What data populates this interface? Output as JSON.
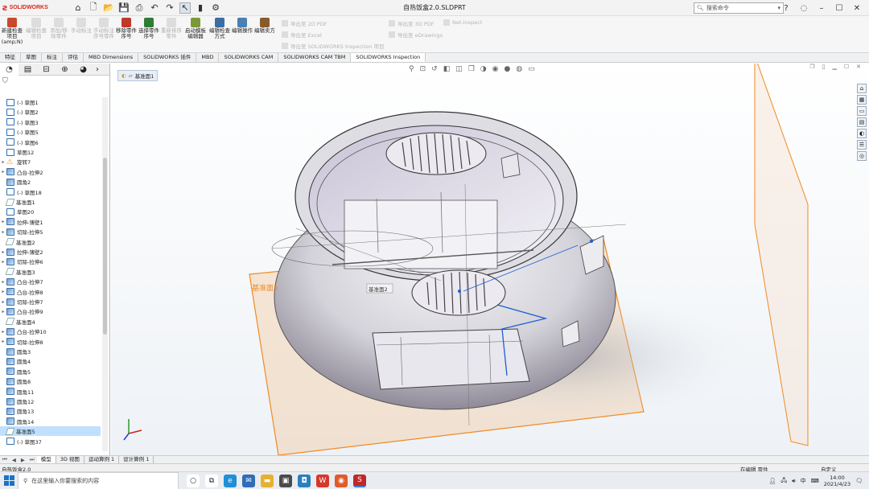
{
  "app": {
    "brand": "SOLIDWORKS",
    "window_title": "自热饭盒2.0.SLDPRT",
    "search_placeholder": "搜索命令",
    "quick_access": [
      "home-icon",
      "new-icon",
      "open-icon",
      "save-icon",
      "print-icon",
      "undo-icon",
      "redo-icon",
      "select-icon",
      "traffic-light-icon",
      "options-icon"
    ]
  },
  "ribbon": {
    "buttons": [
      {
        "label": "新建检查项目(amp;N)",
        "enabled": true,
        "color": "#c84a2a"
      },
      {
        "label": "编辑检查项目",
        "enabled": false,
        "color": "#dddddd"
      },
      {
        "label": "添加/移除零件",
        "enabled": false,
        "color": "#dddddd"
      },
      {
        "label": "手动标注",
        "enabled": false,
        "color": "#dddddd"
      },
      {
        "label": "手动标注序号零件",
        "enabled": false,
        "color": "#dddddd"
      },
      {
        "label": "移除零件序号",
        "enabled": true,
        "color": "#c0392b"
      },
      {
        "label": "选择零件序号",
        "enabled": true,
        "color": "#2e7d32"
      },
      {
        "label": "重新排序零件",
        "enabled": false,
        "color": "#dddddd"
      },
      {
        "label": "启动模板编辑器",
        "enabled": true,
        "color": "#7a9a3a"
      },
      {
        "label": "编辑检查方式",
        "enabled": true,
        "color": "#3a6ea5"
      },
      {
        "label": "编辑操作",
        "enabled": true,
        "color": "#4a7fb5"
      },
      {
        "label": "编辑卖方",
        "enabled": true,
        "color": "#8a5a2a"
      }
    ],
    "small_items": [
      "导出至 2D PDF",
      "导出至 Excel",
      "导出至 SOLIDWORKS Inspection 项目",
      "导出至 3D PDF",
      "导出至 eDrawings",
      "Net-Inspect"
    ]
  },
  "command_tabs": [
    "特征",
    "草图",
    "标注",
    "评估",
    "MBD Dimensions",
    "SOLIDWORKS 插件",
    "MBD",
    "SOLIDWORKS CAM",
    "SOLIDWORKS CAM TBM",
    "SOLIDWORKS Inspection"
  ],
  "active_command_tab": "SOLIDWORKS Inspection",
  "feature_tree": {
    "panel_tabs": [
      "feature-manager-icon",
      "property-manager-icon",
      "configuration-manager-icon",
      "dimxpert-icon",
      "display-manager-icon"
    ],
    "items": [
      {
        "label": "(-) 草图1",
        "type": "sketch",
        "expand": ""
      },
      {
        "label": "(-) 草图2",
        "type": "sketch",
        "expand": ""
      },
      {
        "label": "(-) 草图3",
        "type": "sketch",
        "expand": ""
      },
      {
        "label": "(-) 草图5",
        "type": "sketch",
        "expand": ""
      },
      {
        "label": "(-) 草图6",
        "type": "sketch",
        "expand": ""
      },
      {
        "label": "草图12",
        "type": "sketch",
        "expand": ""
      },
      {
        "label": "旋转7",
        "type": "warn",
        "expand": "▸"
      },
      {
        "label": "凸台-拉伸2",
        "type": "feat",
        "expand": "▸"
      },
      {
        "label": "圆角2",
        "type": "feat",
        "expand": ""
      },
      {
        "label": "(-) 草图18",
        "type": "sketch",
        "expand": ""
      },
      {
        "label": "基准面1",
        "type": "plane",
        "expand": ""
      },
      {
        "label": "草图20",
        "type": "sketch",
        "expand": ""
      },
      {
        "label": "拉伸-薄壁1",
        "type": "feat",
        "expand": "▸"
      },
      {
        "label": "切除-拉伸5",
        "type": "feat",
        "expand": "▸"
      },
      {
        "label": "基准面2",
        "type": "plane",
        "expand": ""
      },
      {
        "label": "拉伸-薄壁2",
        "type": "feat",
        "expand": "▸"
      },
      {
        "label": "切除-拉伸6",
        "type": "feat",
        "expand": "▸"
      },
      {
        "label": "基准面3",
        "type": "plane",
        "expand": ""
      },
      {
        "label": "凸台-拉伸7",
        "type": "feat",
        "expand": "▸"
      },
      {
        "label": "凸台-拉伸8",
        "type": "feat",
        "expand": "▸"
      },
      {
        "label": "切除-拉伸7",
        "type": "feat",
        "expand": "▸"
      },
      {
        "label": "凸台-拉伸9",
        "type": "feat",
        "expand": "▸"
      },
      {
        "label": "基准面4",
        "type": "plane",
        "expand": ""
      },
      {
        "label": "凸台-拉伸10",
        "type": "feat",
        "expand": "▸"
      },
      {
        "label": "切除-拉伸8",
        "type": "feat",
        "expand": "▸"
      },
      {
        "label": "圆角3",
        "type": "feat",
        "expand": ""
      },
      {
        "label": "圆角4",
        "type": "feat",
        "expand": ""
      },
      {
        "label": "圆角5",
        "type": "feat",
        "expand": ""
      },
      {
        "label": "圆角8",
        "type": "feat",
        "expand": ""
      },
      {
        "label": "圆角11",
        "type": "feat",
        "expand": ""
      },
      {
        "label": "圆角12",
        "type": "feat",
        "expand": ""
      },
      {
        "label": "圆角13",
        "type": "feat",
        "expand": ""
      },
      {
        "label": "圆角14",
        "type": "feat",
        "expand": ""
      },
      {
        "label": "基准面5",
        "type": "plane",
        "expand": "",
        "selected": true
      },
      {
        "label": "(-) 草图37",
        "type": "sketch",
        "expand": ""
      }
    ]
  },
  "viewport": {
    "breadcrumb_label": "基准面1",
    "plane_label_main": "基准面5",
    "plane_label_inner": "基准面2",
    "heads_up_icons": [
      "search-icon",
      "zoom-area-icon",
      "previous-view-icon",
      "section-view-icon",
      "dynamic-annotation-icon",
      "view-orientation-icon",
      "display-style-icon",
      "hide-show-icon",
      "edit-appearance-icon",
      "apply-scene-icon",
      "view-settings-icon"
    ]
  },
  "model_tabs": [
    "模型",
    "3D 视图",
    "运动算例 1",
    "设计算例 1"
  ],
  "active_model_tab": "模型",
  "status": {
    "left": "自热饭盒2.0",
    "mid": "在编辑 零件",
    "right": "自定义"
  },
  "taskbar": {
    "search_placeholder": "在这里输入你要搜索的内容",
    "time": "14:00",
    "date": "2021/4/23",
    "ime": "中",
    "apps": [
      {
        "name": "cortana-icon",
        "color": "#ffffff",
        "glyph": "○",
        "fg": "#222222"
      },
      {
        "name": "task-view-icon",
        "color": "#ffffff",
        "glyph": "⧉",
        "fg": "#222222"
      },
      {
        "name": "edge-icon",
        "color": "#1f8fd6",
        "glyph": "e",
        "fg": "#ffffff"
      },
      {
        "name": "mail-icon",
        "color": "#2f6db5",
        "glyph": "✉",
        "fg": "#ffffff"
      },
      {
        "name": "explorer-icon",
        "color": "#e7b12f",
        "glyph": "▬",
        "fg": "#ffffff"
      },
      {
        "name": "store-icon",
        "color": "#4a4a4a",
        "glyph": "▣",
        "fg": "#ffffff"
      },
      {
        "name": "remote-icon",
        "color": "#2a7fc0",
        "glyph": "◘",
        "fg": "#ffffff"
      },
      {
        "name": "wps-icon",
        "color": "#d7372b",
        "glyph": "W",
        "fg": "#ffffff"
      },
      {
        "name": "browser-icon",
        "color": "#e05a2c",
        "glyph": "◉",
        "fg": "#ffffff"
      },
      {
        "name": "solidworks-icon",
        "color": "#c0282a",
        "glyph": "S",
        "fg": "#ffffff"
      }
    ]
  },
  "colors": {
    "accent": "#d52b1e",
    "plane_orange": "#f08a24",
    "selection_blue": "#1e5fd0"
  }
}
